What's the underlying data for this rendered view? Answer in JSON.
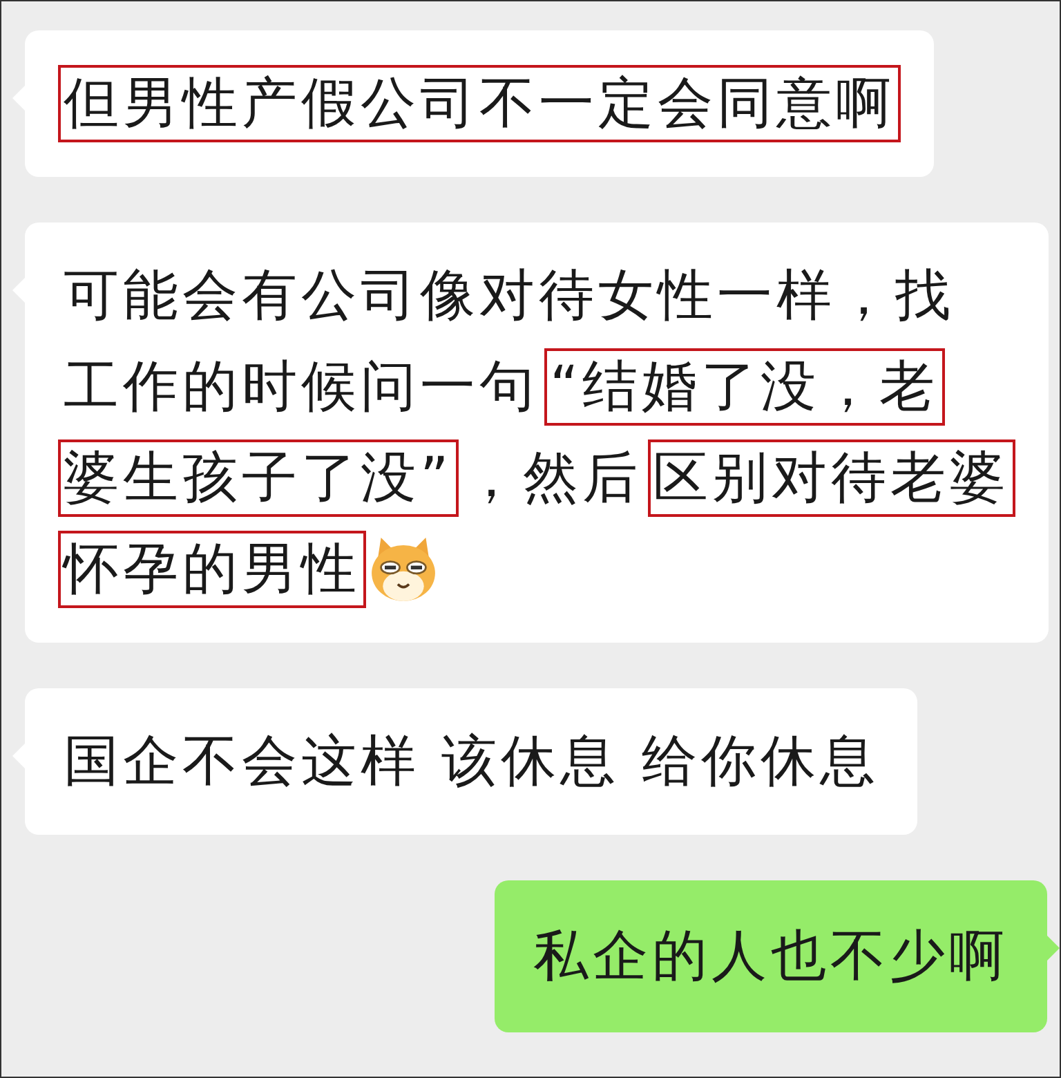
{
  "messages": [
    {
      "kind": "incoming",
      "lines": [
        [
          {
            "kind": "text",
            "text": "但男性产假公司不一定会同意啊",
            "highlighted": true
          }
        ]
      ]
    },
    {
      "kind": "incoming",
      "lines": [
        [
          {
            "kind": "text",
            "text": "可能会有公司像对待女性一样，找",
            "highlighted": false
          }
        ],
        [
          {
            "kind": "text",
            "text": "工作的时候问一句",
            "highlighted": false
          },
          {
            "kind": "text",
            "text": "“结婚了没，老",
            "highlighted": true
          }
        ],
        [
          {
            "kind": "text",
            "text": "婆生孩子了没”",
            "highlighted": true
          },
          {
            "kind": "text",
            "text": "，然后",
            "highlighted": false
          },
          {
            "kind": "text",
            "text": "区别对待老婆",
            "highlighted": true
          }
        ],
        [
          {
            "kind": "text",
            "text": "怀孕的男性",
            "highlighted": true
          },
          {
            "kind": "emoji"
          }
        ]
      ]
    },
    {
      "kind": "incoming",
      "lines": [
        [
          {
            "kind": "text",
            "text": "国企不会这样 该休息 给你休息",
            "highlighted": false
          }
        ]
      ]
    },
    {
      "kind": "outgoing",
      "lines": [
        [
          {
            "kind": "text",
            "text": "私企的人也不少啊",
            "highlighted": false
          }
        ]
      ]
    }
  ]
}
